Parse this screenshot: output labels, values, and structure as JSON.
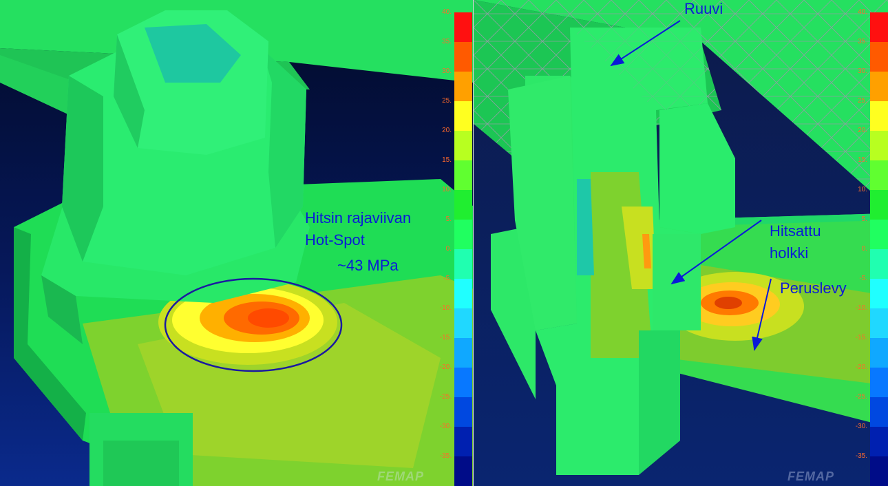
{
  "left_panel": {
    "annotation_line1": "Hitsin rajaviivan",
    "annotation_line2": "Hot-Spot",
    "annotation_value": "~43 MPa"
  },
  "right_panel": {
    "label_bolt": "Ruuvi",
    "label_bushing_line1": "Hitsattu",
    "label_bushing_line2": "holkki",
    "label_plate": "Peruslevy"
  },
  "legend": {
    "ticks": [
      "40.",
      "35.",
      "30.",
      "25.",
      "20.",
      "15.",
      "10.",
      "5.",
      "0.",
      "-5.",
      "-10.",
      "-15.",
      "-20.",
      "-25.",
      "-30.",
      "-35."
    ],
    "colors": [
      "#ff1010",
      "#ff5a00",
      "#ffa000",
      "#ffff20",
      "#b8ff20",
      "#60ff30",
      "#20ee30",
      "#20ff60",
      "#20ffb0",
      "#20ffff",
      "#20d8ff",
      "#10a8ff",
      "#0878ff",
      "#0048e0",
      "#0020b0",
      "#000c88"
    ]
  },
  "watermark": "FEMAP",
  "colors": {
    "annotation": "#0a1ad8",
    "circle": "#1a1aa0"
  }
}
